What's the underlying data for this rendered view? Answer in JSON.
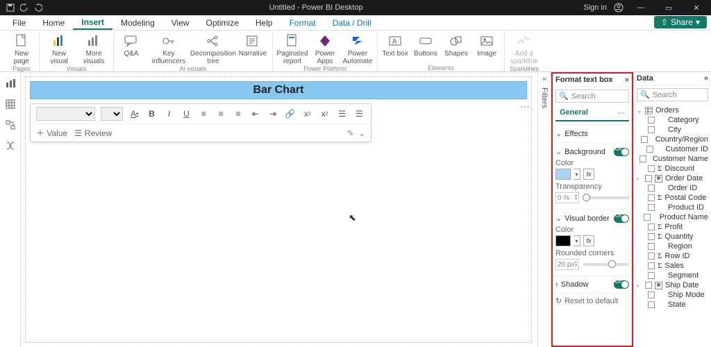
{
  "titlebar": {
    "title": "Untitled - Power BI Desktop",
    "sign_in": "Sign in"
  },
  "tabs": {
    "file": "File",
    "home": "Home",
    "insert": "Insert",
    "modeling": "Modeling",
    "view": "View",
    "optimize": "Optimize",
    "help": "Help",
    "format": "Format",
    "datadrill": "Data / Drill",
    "share": "Share"
  },
  "ribbon": {
    "pages": {
      "new_page": "New page",
      "label": "Pages"
    },
    "visuals": {
      "new_visual": "New visual",
      "more_visuals": "More visuals",
      "label": "Visuals"
    },
    "ai": {
      "qa": "Q&A",
      "key": "Key influencers",
      "decomp": "Decomposition tree",
      "narr": "Narrative",
      "label": "AI visuals"
    },
    "pp": {
      "pr": "Paginated report",
      "pa": "Power Apps",
      "au": "Power Automate",
      "label": "Power Platform"
    },
    "el": {
      "tb": "Text box",
      "btn": "Buttons",
      "shp": "Shapes",
      "img": "Image",
      "label": "Elements"
    },
    "spark": {
      "add": "Add a sparkline",
      "label": "Sparklines"
    }
  },
  "collapse_rail": {
    "label": "Filters"
  },
  "canvas": {
    "title": "Bar Chart",
    "value": "Value",
    "review": "Review"
  },
  "format": {
    "header": "Format text box",
    "search_ph": "Search",
    "general": "General",
    "effects": "Effects",
    "background": "Background",
    "color": "Color",
    "transparency": "Transparency",
    "trans_val": "0 %",
    "visual_border": "Visual border",
    "rounded": "Rounded corners",
    "round_val": "20 px",
    "shadow": "Shadow",
    "reset": "Reset to default",
    "on": "On"
  },
  "data": {
    "header": "Data",
    "search_ph": "Search",
    "table": "Orders",
    "fields": [
      {
        "name": "Category",
        "sigma": false,
        "date": false
      },
      {
        "name": "City",
        "sigma": false,
        "date": false
      },
      {
        "name": "Country/Region",
        "sigma": false,
        "date": false
      },
      {
        "name": "Customer ID",
        "sigma": false,
        "date": false
      },
      {
        "name": "Customer Name",
        "sigma": false,
        "date": false
      },
      {
        "name": "Discount",
        "sigma": true,
        "date": false
      },
      {
        "name": "Order Date",
        "sigma": false,
        "date": true,
        "expand": true
      },
      {
        "name": "Order ID",
        "sigma": false,
        "date": false
      },
      {
        "name": "Postal Code",
        "sigma": true,
        "date": false
      },
      {
        "name": "Product ID",
        "sigma": false,
        "date": false
      },
      {
        "name": "Product Name",
        "sigma": false,
        "date": false
      },
      {
        "name": "Profit",
        "sigma": true,
        "date": false
      },
      {
        "name": "Quantity",
        "sigma": true,
        "date": false
      },
      {
        "name": "Region",
        "sigma": false,
        "date": false
      },
      {
        "name": "Row ID",
        "sigma": true,
        "date": false
      },
      {
        "name": "Sales",
        "sigma": true,
        "date": false
      },
      {
        "name": "Segment",
        "sigma": false,
        "date": false
      },
      {
        "name": "Ship Date",
        "sigma": false,
        "date": true,
        "expand": true
      },
      {
        "name": "Ship Mode",
        "sigma": false,
        "date": false
      },
      {
        "name": "State",
        "sigma": false,
        "date": false
      }
    ]
  }
}
